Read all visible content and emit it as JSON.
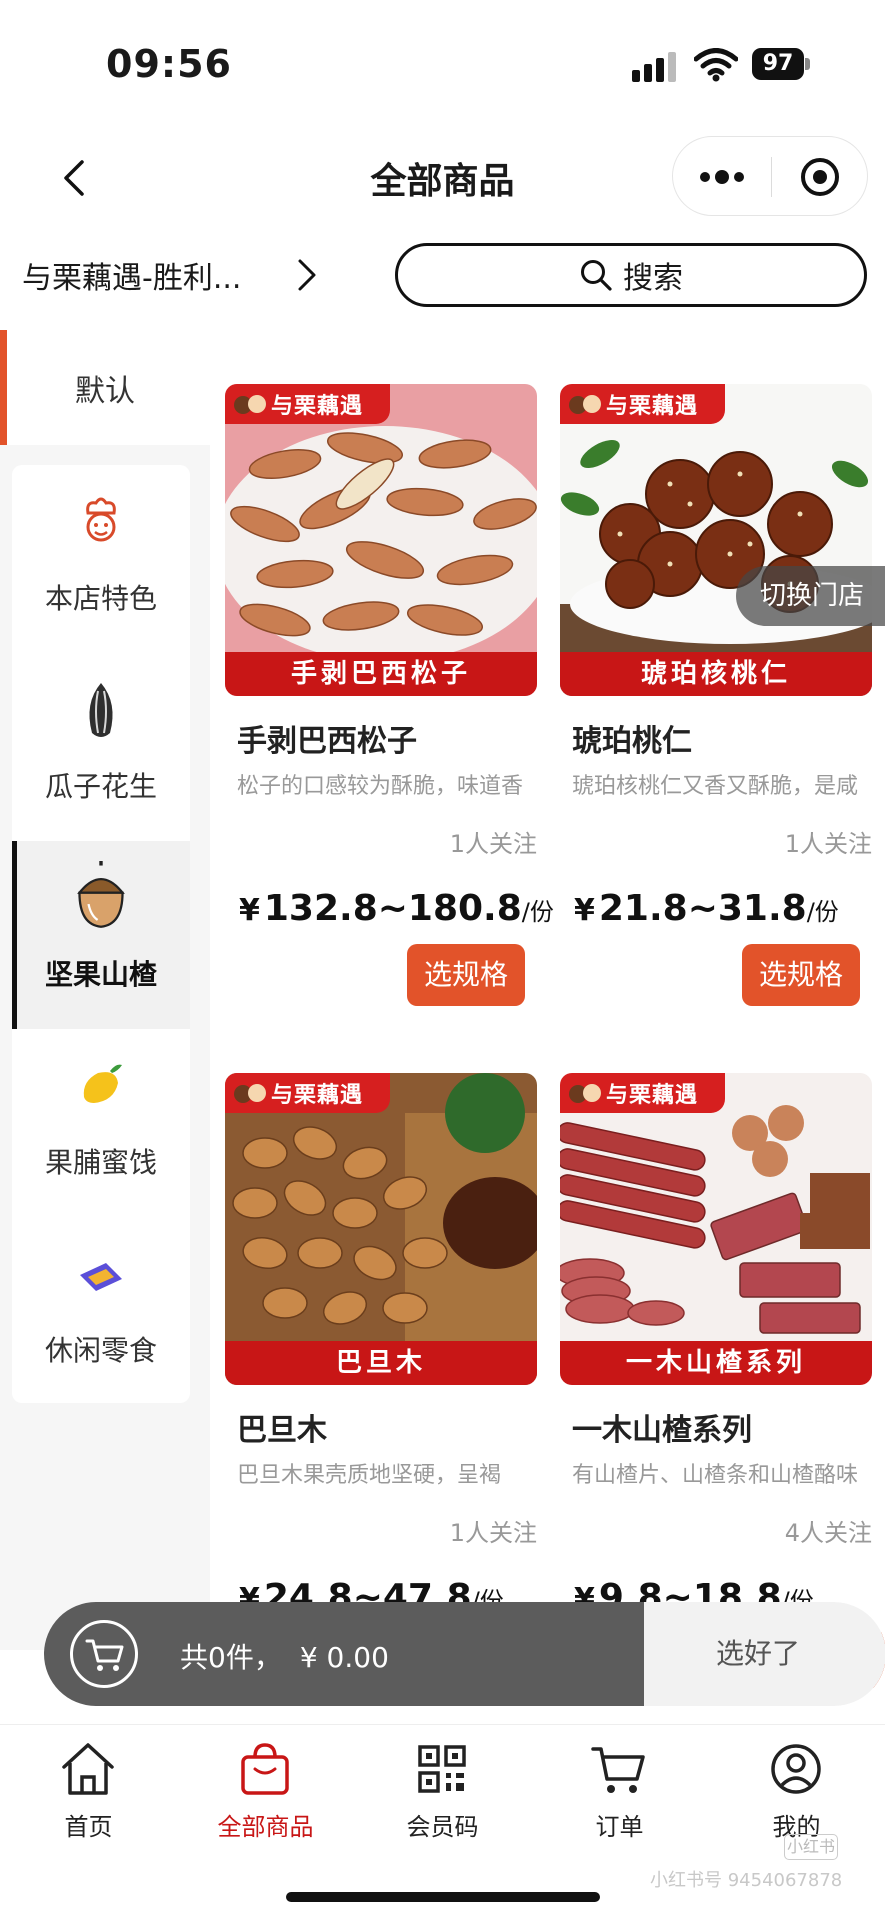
{
  "status_bar": {
    "time": "09:56",
    "battery": "97"
  },
  "header": {
    "title": "全部商品"
  },
  "store": {
    "name": "与栗藕遇-胜利..."
  },
  "search": {
    "label": "搜索"
  },
  "sidebar": {
    "default_label": "默认",
    "items": [
      {
        "label": "本店特色",
        "icon": "chef-icon"
      },
      {
        "label": "瓜子花生",
        "icon": "sunflower-seed-icon"
      },
      {
        "label": "坚果山楂",
        "icon": "hazelnut-icon",
        "active": true
      },
      {
        "label": "果脯蜜饯",
        "icon": "mango-icon"
      },
      {
        "label": "休闲零食",
        "icon": "snack-bag-icon"
      }
    ]
  },
  "products": [
    {
      "brand": "与栗藕遇",
      "banner": "手剥巴西松子",
      "name": "手剥巴西松子",
      "desc": "松子的口感较为酥脆，味道香",
      "followers": "1人关注",
      "price": "132.8~180.8",
      "unit": "/份",
      "button": "选规格"
    },
    {
      "brand": "与栗藕遇",
      "banner": "琥珀核桃仁",
      "name": "琥珀桃仁",
      "desc": "琥珀核桃仁又香又酥脆，是咸",
      "followers": "1人关注",
      "price": "21.8~31.8",
      "unit": "/份",
      "button": "选规格"
    },
    {
      "brand": "与栗藕遇",
      "banner": "巴旦木",
      "name": "巴旦木",
      "desc": "巴旦木果壳质地坚硬，呈褐",
      "followers": "1人关注",
      "price": "24.8~47.8",
      "unit": "/份",
      "button": ""
    },
    {
      "brand": "与栗藕遇",
      "banner": "一木山楂系列",
      "name": "一木山楂系列",
      "desc": "有山楂片、山楂条和山楂酪味",
      "followers": "4人关注",
      "price": "9.8~18.8",
      "unit": "/份",
      "button": ""
    }
  ],
  "currency_symbol": "¥",
  "switch_store": "切换门店",
  "cart": {
    "count_text": "共0件，",
    "total": "¥ 0.00",
    "done": "选好了"
  },
  "tabs": [
    {
      "label": "首页",
      "icon": "home-icon"
    },
    {
      "label": "全部商品",
      "icon": "shopping-bag-icon",
      "active": true
    },
    {
      "label": "会员码",
      "icon": "qr-code-icon"
    },
    {
      "label": "订单",
      "icon": "cart-icon"
    },
    {
      "label": "我的",
      "icon": "user-icon"
    }
  ],
  "watermark": {
    "text": "小红书号 9454067878",
    "box": "小红书"
  },
  "colors": {
    "accent": "#e2532a",
    "brand_red": "#c81616",
    "cart_dark": "#5c5c5c"
  }
}
